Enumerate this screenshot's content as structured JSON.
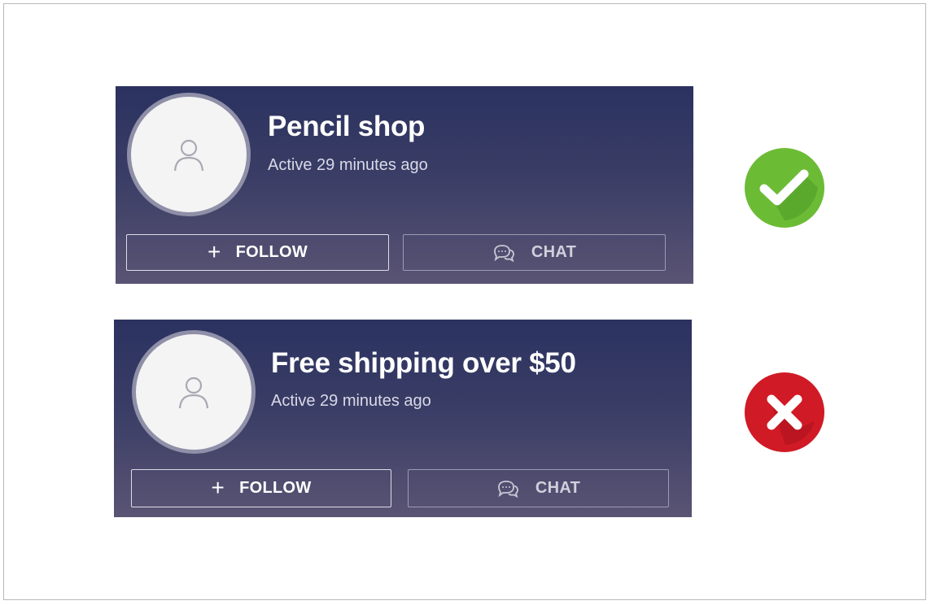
{
  "cards": [
    {
      "shop_name": "Pencil shop",
      "status": "Active 29 minutes ago",
      "follow_label": "FOLLOW",
      "chat_label": "CHAT",
      "verdict": "check-icon"
    },
    {
      "shop_name": "Free shipping over $50",
      "status": "Active 29 minutes ago",
      "follow_label": "FOLLOW",
      "chat_label": "CHAT",
      "verdict": "cross-icon"
    }
  ],
  "colors": {
    "card_top": "#2b3260",
    "card_bottom": "#5a5474",
    "check_green": "#6cbb35",
    "cross_red": "#d01a26"
  },
  "icons": {
    "avatar": "user-icon",
    "follow": "plus-icon",
    "chat": "chat-bubbles-icon"
  }
}
